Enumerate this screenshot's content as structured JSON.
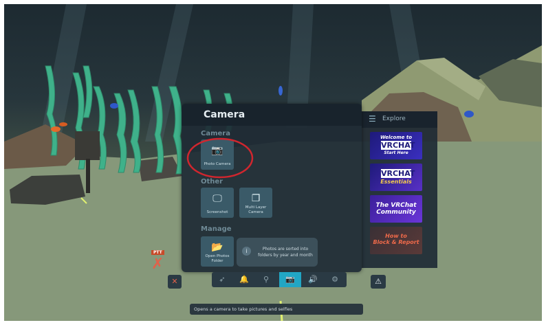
{
  "camera_menu": {
    "title": "Camera",
    "sections": {
      "camera": "Camera",
      "other": "Other",
      "manage": "Manage"
    },
    "tiles": {
      "photo_camera": "Photo Camera",
      "screenshot": "Screenshot",
      "multi_layer_camera": "Multi Layer Camera",
      "open_photos_folder": "Open Photos Folder"
    },
    "info_text": "Photos are sorted into folders by year and month"
  },
  "explore_panel": {
    "title": "Explore",
    "banners": [
      {
        "line1": "Welcome to",
        "line2": "VRCHAT",
        "line3": "Start Here"
      },
      {
        "line1": "",
        "line2": "VRCHAT",
        "line3": "Essentials"
      },
      {
        "line1": "The VRChat",
        "line2": "Community",
        "line3": ""
      },
      {
        "line1": "How to",
        "line2": "Block & Report",
        "line3": ""
      }
    ]
  },
  "hud": {
    "ptt_label": "PTT",
    "tooltip": "Opens a camera to take pictures and selfies"
  },
  "icons": {
    "rocket": "rocket-icon",
    "bell": "bell-icon",
    "location": "location-pin-icon",
    "camera": "camera-icon",
    "volume": "volume-icon",
    "settings": "gear-icon"
  },
  "colors": {
    "panel_bg": "#1e2a34",
    "tile_bg": "#3a5a68",
    "highlight_circle": "#d0262e",
    "active_tab": "#21a6c4",
    "seaweed": "#3fb18a"
  }
}
